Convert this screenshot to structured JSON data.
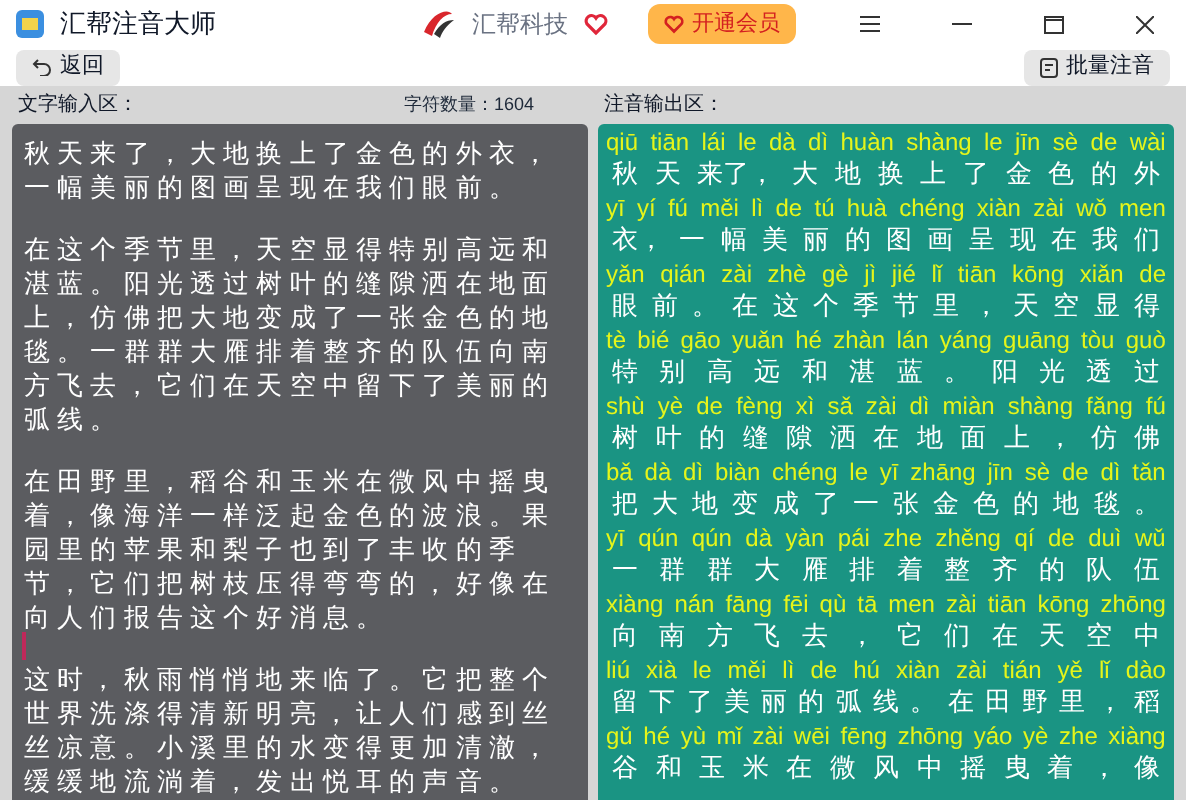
{
  "window": {
    "title": "汇帮注音大师",
    "brand": "汇帮科技",
    "vip_button": "开通会员"
  },
  "toolbar": {
    "back": "返回",
    "batch": "批量注音"
  },
  "input": {
    "label": "文字输入区：",
    "count": "字符数量：1604",
    "paragraphs": [
      {
        "lines": [
          "秋天来了，大地换上了金色的外衣，",
          "一幅美丽的图画呈现在我们眼前。"
        ]
      },
      {
        "lines": [
          "在这个季节里，天空显得特别高远和",
          "湛蓝。阳光透过树叶的缝隙洒在地面",
          "上，仿佛把大地变成了一张金色的地",
          "毯。一群群大雁排着整齐的队伍向南",
          "方飞去，它们在天空中留下了美丽的",
          "弧线。"
        ]
      },
      {
        "lines": [
          "在田野里，稻谷和玉米在微风中摇曳",
          "着，像海洋一样泛起金色的波浪。果",
          "园里的苹果和梨子也到了丰收的季",
          "节，它们把树枝压得弯弯的，好像在",
          "向人们报告这个好消息。"
        ]
      },
      {
        "lines": [
          "这时，秋雨悄悄地来临了。它把整个",
          "世界洗涤得清新明亮，让人们感到丝",
          "丝凉意。小溪里的水变得更加清澈，",
          "缓缓地流淌着，发出悦耳的声音。"
        ]
      }
    ]
  },
  "output": {
    "label": "注音输出区：",
    "rows": [
      {
        "pinyin": "qiū tiān lái le dà dì huàn shàng le jīn sè de wài",
        "hanzi": "秋 天 来了， 大 地 换 上 了 金 色 的 外"
      },
      {
        "pinyin": "yī yí fú měi lì de tú huà chéng xiàn zài wǒ men",
        "hanzi": "衣， 一 幅 美 丽 的 图 画 呈 现 在 我 们"
      },
      {
        "pinyin": "yǎn qián zài zhè gè jì jié lǐ tiān kōng xiǎn de",
        "hanzi": "眼 前 。 在 这 个 季 节 里 ， 天 空 显 得"
      },
      {
        "pinyin": "tè bié gāo yuǎn hé zhàn lán yáng guāng tòu guò",
        "hanzi": "特 别 高 远 和 湛 蓝 。 阳 光 透 过"
      },
      {
        "pinyin": "shù yè de fèng xì sǎ zài dì miàn shàng fǎng fú",
        "hanzi": "树 叶 的 缝 隙 洒 在 地 面 上 ， 仿 佛"
      },
      {
        "pinyin": "bǎ dà dì biàn chéng le yī zhāng jīn sè de dì tǎn",
        "hanzi": "把 大 地 变 成 了 一 张 金 色 的 地 毯 。"
      },
      {
        "pinyin": "yī qún qún dà yàn pái zhe zhěng qí de duì wǔ",
        "hanzi": "一 群 群 大 雁 排 着 整 齐 的 队 伍"
      },
      {
        "pinyin": "xiàng nán fāng fēi qù tā men zài tiān kōng zhōng",
        "hanzi": "向 南 方 飞 去 ， 它 们 在 天 空 中"
      },
      {
        "pinyin": "liú xià le měi lì de hú xiàn zài tián yě lǐ dào",
        "hanzi": "留 下 了 美 丽 的 弧 线 。 在 田 野 里 ， 稻"
      },
      {
        "pinyin": "gǔ hé yù mǐ zài wēi fēng zhōng yáo yè zhe xiàng",
        "hanzi": "谷 和 玉 米 在 微 风 中 摇 曳 着 ， 像"
      }
    ]
  }
}
